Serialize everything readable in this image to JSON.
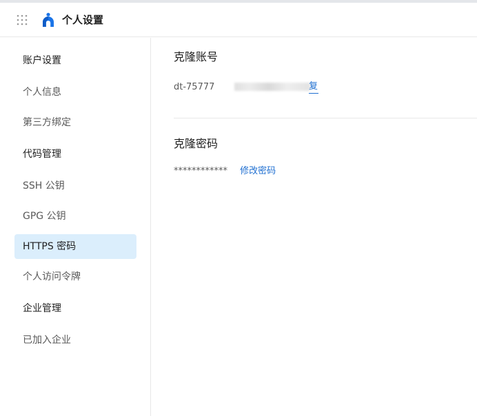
{
  "header": {
    "title": "个人设置",
    "menu_icon": "grid-dots-icon",
    "logo_icon": "app-logo-icon",
    "accent_color": "#1f6fd1"
  },
  "sidebar": {
    "items": [
      {
        "label": "账户设置",
        "type": "group"
      },
      {
        "label": "个人信息",
        "type": "item"
      },
      {
        "label": "第三方绑定",
        "type": "item"
      },
      {
        "label": "代码管理",
        "type": "group"
      },
      {
        "label": "SSH 公钥",
        "type": "item"
      },
      {
        "label": "GPG 公钥",
        "type": "item"
      },
      {
        "label": "HTTPS 密码",
        "type": "item",
        "active": true
      },
      {
        "label": "个人访问令牌",
        "type": "item"
      },
      {
        "label": "企业管理",
        "type": "group"
      },
      {
        "label": "已加入企业",
        "type": "item"
      }
    ],
    "active_color": "#dbeefc"
  },
  "main": {
    "clone_account": {
      "title": "克隆账号",
      "value_prefix": "dt-75777",
      "copy_label": "复"
    },
    "clone_password": {
      "title": "克隆密码",
      "masked_value": "************",
      "change_label": "修改密码"
    }
  }
}
